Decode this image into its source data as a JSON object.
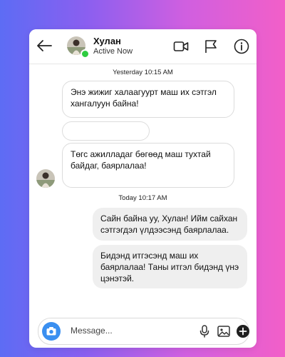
{
  "header": {
    "contact_name": "Хулан",
    "status": "Active Now",
    "icons": [
      "back-arrow-icon",
      "video-camera-icon",
      "flag-icon",
      "info-icon"
    ]
  },
  "conversation": {
    "timestamp_1": "Yesterday 10:15 AM",
    "msg_1": "Энэ жижиг халаагуурт маш их сэтгэл хангалуун байна!",
    "msg_2": "",
    "msg_3": "Төгс ажилладаг бөгөөд маш тухтай байдаг, баярлалаа!",
    "timestamp_2": "Today 10:17 AM",
    "msg_4": "Сайн байна уу, Хулан! Ийм сайхан сэтгэгдэл үлдээсэнд баярлалаа.",
    "msg_5": "Бидэнд итгэсэнд маш их баярлалаа! Таны итгэл бидэнд үнэ цэнэтэй."
  },
  "composer": {
    "placeholder": "Message...",
    "icons": [
      "camera-icon",
      "microphone-icon",
      "image-icon",
      "add-icon"
    ]
  },
  "colors": {
    "accent": "#3a8ff0",
    "online": "#2ecc40",
    "incoming_border": "#dcdcdc",
    "outgoing_bg": "#efefef"
  }
}
